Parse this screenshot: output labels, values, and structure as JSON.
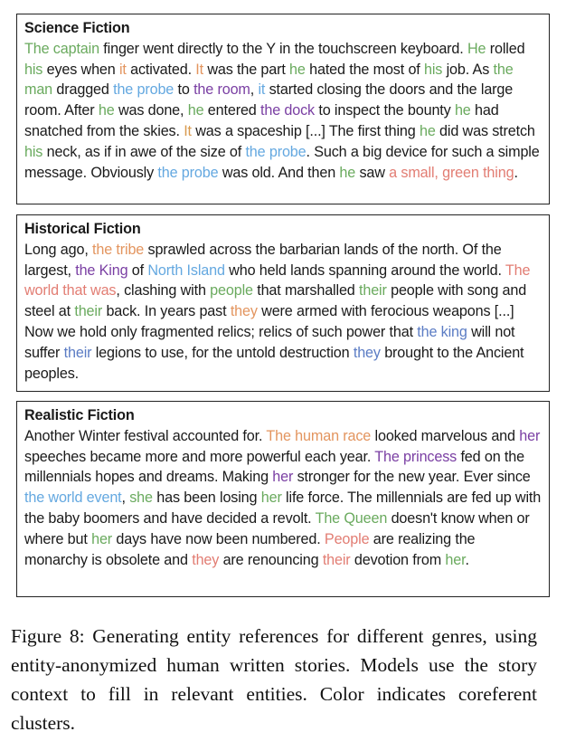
{
  "colors": {
    "green": "#6aaa5e",
    "orange": "#e3955f",
    "tan": "#d99a4e",
    "lightblue": "#64a8e0",
    "purple": "#7a3fa3",
    "steelblue": "#5b7cc4",
    "salmon": "#e27d73",
    "text": "#1a1a1a"
  },
  "panels": [
    {
      "title": "Science Fiction",
      "segments": [
        {
          "t": "The captain",
          "c": "green"
        },
        {
          "t": " finger went directly to the Y in the touchscreen keyboard. "
        },
        {
          "t": "He",
          "c": "green"
        },
        {
          "t": " rolled "
        },
        {
          "t": "his",
          "c": "green"
        },
        {
          "t": " eyes when "
        },
        {
          "t": "it",
          "c": "orange"
        },
        {
          "t": " activated. "
        },
        {
          "t": "It",
          "c": "orange"
        },
        {
          "t": " was the part "
        },
        {
          "t": "he",
          "c": "green"
        },
        {
          "t": " hated the most of "
        },
        {
          "t": "his",
          "c": "green"
        },
        {
          "t": " job. As "
        },
        {
          "t": "the man",
          "c": "green"
        },
        {
          "t": " dragged "
        },
        {
          "t": "the probe",
          "c": "lightblue"
        },
        {
          "t": " to "
        },
        {
          "t": "the room",
          "c": "purple"
        },
        {
          "t": ", "
        },
        {
          "t": "it",
          "c": "lightblue"
        },
        {
          "t": " started closing the doors and the large room. After "
        },
        {
          "t": "he",
          "c": "green"
        },
        {
          "t": " was done, "
        },
        {
          "t": "he",
          "c": "green"
        },
        {
          "t": " entered "
        },
        {
          "t": "the dock",
          "c": "purple"
        },
        {
          "t": " to inspect the bounty "
        },
        {
          "t": "he",
          "c": "green"
        },
        {
          "t": " had snatched from the skies. "
        },
        {
          "t": "It",
          "c": "tan"
        },
        {
          "t": " was a spaceship [...] The first thing "
        },
        {
          "t": "he",
          "c": "green"
        },
        {
          "t": " did was stretch "
        },
        {
          "t": "his",
          "c": "green"
        },
        {
          "t": " neck, as if in awe of the size of "
        },
        {
          "t": "the probe",
          "c": "lightblue"
        },
        {
          "t": ". Such a big device for such a simple message. Obviously "
        },
        {
          "t": "the probe",
          "c": "lightblue"
        },
        {
          "t": " was old. And then "
        },
        {
          "t": "he",
          "c": "green"
        },
        {
          "t": " saw "
        },
        {
          "t": "a small, green thing",
          "c": "salmon"
        },
        {
          "t": "."
        }
      ]
    },
    {
      "title": "Historical Fiction",
      "segments": [
        {
          "t": "Long ago, "
        },
        {
          "t": "the tribe",
          "c": "orange"
        },
        {
          "t": " sprawled across the barbarian lands of the north. Of the largest, "
        },
        {
          "t": "the King",
          "c": "purple"
        },
        {
          "t": " of "
        },
        {
          "t": "North Island",
          "c": "lightblue"
        },
        {
          "t": " who held lands spanning around the world. "
        },
        {
          "t": "The world that was",
          "c": "salmon"
        },
        {
          "t": ", clashing with "
        },
        {
          "t": "people",
          "c": "green"
        },
        {
          "t": " that marshalled "
        },
        {
          "t": "their",
          "c": "green"
        },
        {
          "t": " people with song and steel at "
        },
        {
          "t": "their",
          "c": "green"
        },
        {
          "t": " back. In years past "
        },
        {
          "t": "they",
          "c": "orange"
        },
        {
          "t": " were armed with ferocious weapons [...] Now we hold only fragmented relics; relics of such power that "
        },
        {
          "t": "the king",
          "c": "steelblue"
        },
        {
          "t": " will not suffer "
        },
        {
          "t": "their",
          "c": "steelblue"
        },
        {
          "t": " legions to use, for the untold destruction "
        },
        {
          "t": "they",
          "c": "steelblue"
        },
        {
          "t": " brought to the Ancient peoples."
        }
      ]
    },
    {
      "title": "Realistic Fiction",
      "segments": [
        {
          "t": "Another Winter festival accounted for. "
        },
        {
          "t": "The human race",
          "c": "orange"
        },
        {
          "t": " looked marvelous and "
        },
        {
          "t": "her",
          "c": "purple"
        },
        {
          "t": " speeches became more and more powerful each year. "
        },
        {
          "t": "The princess",
          "c": "purple"
        },
        {
          "t": " fed on the millennials hopes and dreams. Making "
        },
        {
          "t": "her",
          "c": "purple"
        },
        {
          "t": " stronger for the new year. Ever since "
        },
        {
          "t": "the world event",
          "c": "lightblue"
        },
        {
          "t": ", "
        },
        {
          "t": "she",
          "c": "green"
        },
        {
          "t": " has been losing "
        },
        {
          "t": "her",
          "c": "green"
        },
        {
          "t": " life force. The millennials are fed up with the baby boomers and have decided a revolt. "
        },
        {
          "t": "The Queen",
          "c": "green"
        },
        {
          "t": " doesn't know when or where but "
        },
        {
          "t": "her",
          "c": "green"
        },
        {
          "t": " days have now been numbered. "
        },
        {
          "t": "People",
          "c": "salmon"
        },
        {
          "t": " are realizing the monarchy is obsolete and "
        },
        {
          "t": "they",
          "c": "salmon"
        },
        {
          "t": " are renouncing "
        },
        {
          "t": "their",
          "c": "salmon"
        },
        {
          "t": " devotion from "
        },
        {
          "t": "her",
          "c": "green"
        },
        {
          "t": "."
        }
      ]
    }
  ],
  "caption": "Figure 8:  Generating entity references for different genres, using entity-anonymized human written stories. Models use the story context to fill in relevant entities. Color indicates coreferent clusters."
}
